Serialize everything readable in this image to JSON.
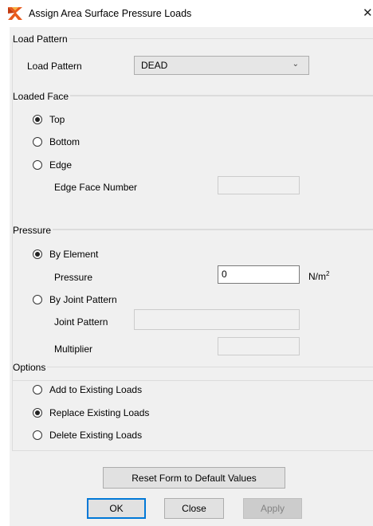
{
  "window": {
    "title": "Assign Area Surface Pressure Loads",
    "close_glyph": "✕"
  },
  "load_pattern": {
    "group_label": "Load Pattern",
    "field_label": "Load Pattern",
    "selected": "DEAD"
  },
  "loaded_face": {
    "group_label": "Loaded Face",
    "options": [
      "Top",
      "Bottom",
      "Edge"
    ],
    "selected": "Top",
    "edge_face_label": "Edge Face Number",
    "edge_face_value": ""
  },
  "pressure": {
    "group_label": "Pressure",
    "by_element_label": "By Element",
    "pressure_label": "Pressure",
    "pressure_value": "0",
    "unit_base": "N/m",
    "unit_exp": "2",
    "by_joint_label": "By Joint Pattern",
    "joint_pattern_label": "Joint Pattern",
    "joint_pattern_value": "",
    "multiplier_label": "Multiplier",
    "multiplier_value": "",
    "selected": "By Element"
  },
  "options": {
    "group_label": "Options",
    "items": [
      "Add to Existing Loads",
      "Replace Existing Loads",
      "Delete Existing Loads"
    ],
    "selected": "Replace Existing Loads"
  },
  "buttons": {
    "reset": "Reset Form to Default Values",
    "ok": "OK",
    "close": "Close",
    "apply": "Apply"
  },
  "colors": {
    "dialog_bg": "#f0f0f0",
    "accent": "#0078d7"
  }
}
